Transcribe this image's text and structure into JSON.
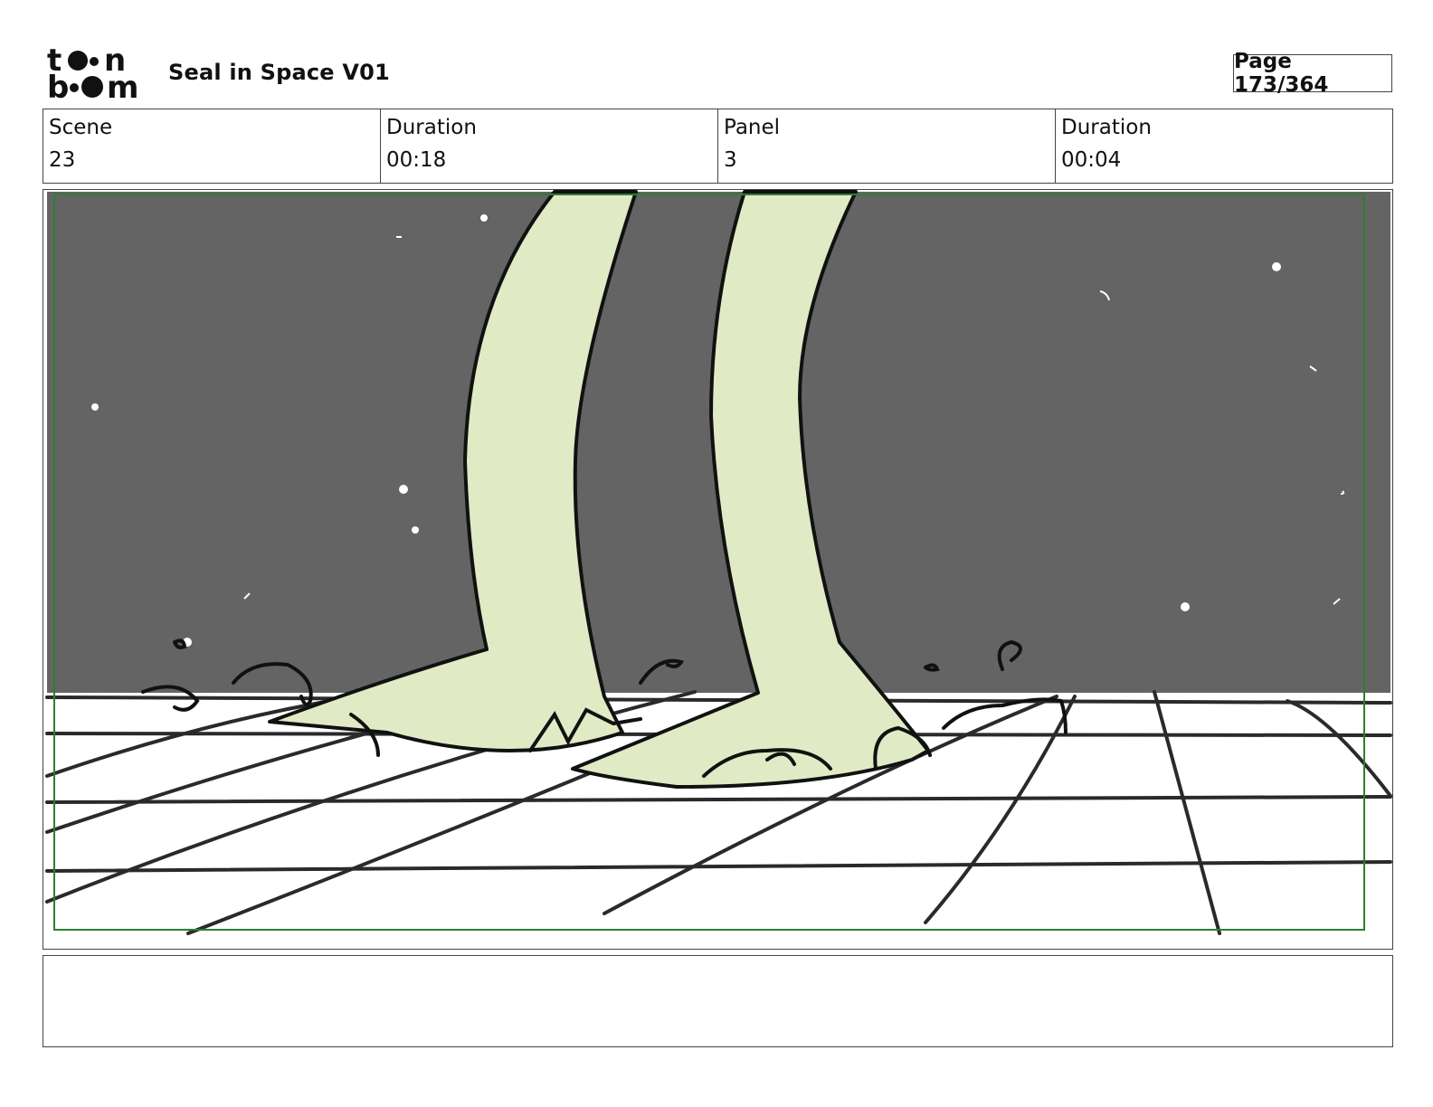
{
  "header": {
    "logo_text": "toon boom",
    "project_title": "Seal in Space V01",
    "page_label": "Page 173/364"
  },
  "info": {
    "scene_label": "Scene",
    "scene_value": "23",
    "scene_duration_label": "Duration",
    "scene_duration_value": "00:18",
    "panel_label": "Panel",
    "panel_value": "3",
    "panel_duration_label": "Duration",
    "panel_duration_value": "00:04"
  },
  "panel": {
    "colors": {
      "space": "#646464",
      "leg_fill": "#e0eac4",
      "line": "#111111",
      "grid": "#2a2a2a",
      "safe_frame": "#2e7d32"
    }
  },
  "notes": {
    "text": ""
  }
}
